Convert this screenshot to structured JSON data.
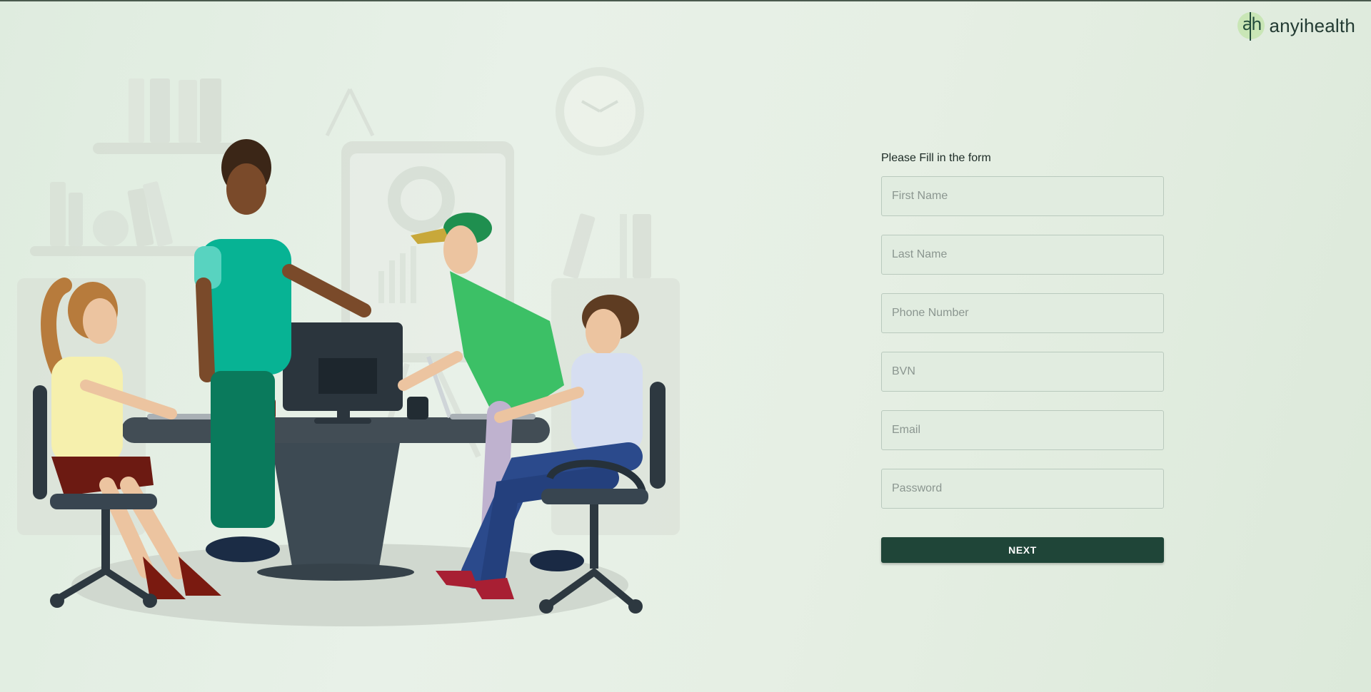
{
  "brand": {
    "name": "anyihealth",
    "mark": "ah"
  },
  "form": {
    "title": "Please Fill in the form",
    "fields": [
      {
        "placeholder": "First Name",
        "value": ""
      },
      {
        "placeholder": "Last Name",
        "value": ""
      },
      {
        "placeholder": "Phone Number",
        "value": ""
      },
      {
        "placeholder": "BVN",
        "value": ""
      },
      {
        "placeholder": "Email",
        "value": ""
      },
      {
        "placeholder": "Password",
        "value": ""
      }
    ],
    "next_label": "NEXT"
  },
  "colors": {
    "background": "#e4eee2",
    "button": "#1f4538",
    "brand_mark": "#c9e6b6"
  },
  "illustration": {
    "subject": "team-working-at-table-illustration"
  }
}
